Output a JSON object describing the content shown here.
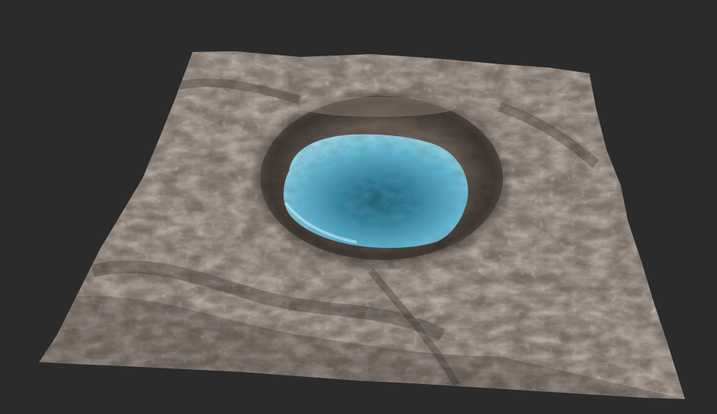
{
  "scene": {
    "background_color": "#2b2b2b",
    "terrain": {
      "description_colors": {
        "rock_base": "#7d6e63",
        "rock_light": "#a89a8d",
        "rock_dark": "#3f3630",
        "shadow": "#2a2420",
        "snow_highlight": "#c9c4bd"
      }
    },
    "crater_lake": {
      "colors": {
        "water_light": "#9fd6e6",
        "water_mid": "#5fb3cd",
        "water_deep": "#2f7f9b",
        "water_center": "#1f5d73"
      }
    }
  }
}
